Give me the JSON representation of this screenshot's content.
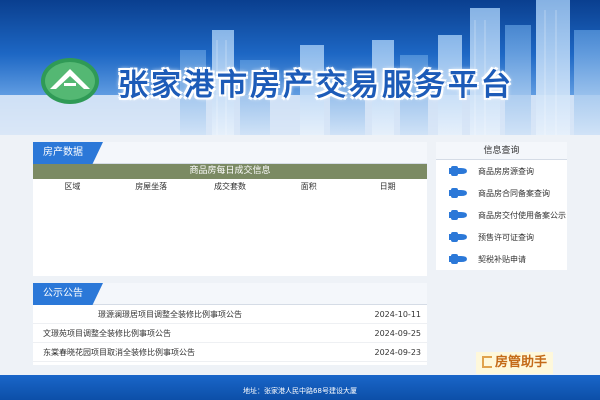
{
  "header": {
    "site_title": "张家港市房产交易服务平台"
  },
  "property_data": {
    "tab_label": "房产数据",
    "table_title": "商品房每日成交信息",
    "columns": [
      "区域",
      "房屋坐落",
      "成交套数",
      "面积",
      "日期"
    ]
  },
  "notices": {
    "tab_label": "公示公告",
    "items": [
      {
        "title": "璟源澜璟居项目调整全装修比例事项公告",
        "date": "2024-10-11"
      },
      {
        "title": "文璟苑项目调整全装修比例事项公告",
        "date": "2024-09-25"
      },
      {
        "title": "东棠春晓花园项目取消全装修比例事项公告",
        "date": "2024-09-23"
      }
    ]
  },
  "info_query": {
    "title": "信息查询",
    "items": [
      {
        "label": "商品房房源查询",
        "icon": "hand-pointer-icon"
      },
      {
        "label": "商品房合同备案查询",
        "icon": "hand-pointer-icon"
      },
      {
        "label": "商品房交付使用备案公示",
        "icon": "hand-pointer-icon"
      },
      {
        "label": "预售许可证查询",
        "icon": "hand-pointer-icon"
      },
      {
        "label": "契税补贴申请",
        "icon": "hand-pointer-icon"
      }
    ]
  },
  "watermark": {
    "text": "房管助手"
  },
  "footer": {
    "address": "地址：张家港人民中路68号建设大厦"
  },
  "colors": {
    "primary": "#2b78d8",
    "table_header": "#7b8a63",
    "footer": "#1a66c9"
  }
}
